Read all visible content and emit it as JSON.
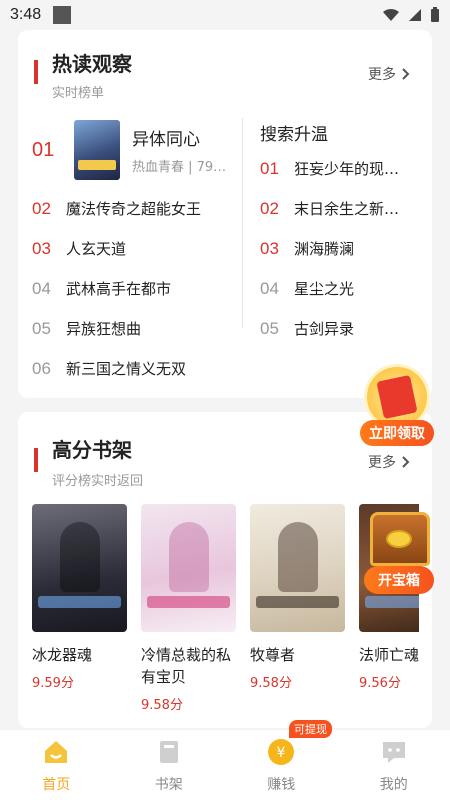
{
  "status_bar": {
    "time": "3:48"
  },
  "hot_read": {
    "title": "热读观察",
    "subtitle": "实时榜单",
    "more": "更多",
    "top_book": {
      "rank": "01",
      "title": "异体同心",
      "meta": "热血青春 | 79…"
    },
    "ranks": [
      {
        "rank": "02",
        "title": "魔法传奇之超能女王"
      },
      {
        "rank": "03",
        "title": "人玄天道"
      },
      {
        "rank": "04",
        "title": "武林高手在都市"
      },
      {
        "rank": "05",
        "title": "异族狂想曲"
      },
      {
        "rank": "06",
        "title": "新三国之情义无双"
      }
    ],
    "search_title": "搜索升温",
    "search_ranks": [
      {
        "rank": "01",
        "title": "狂妄少年的现…"
      },
      {
        "rank": "02",
        "title": "末日余生之新…"
      },
      {
        "rank": "03",
        "title": "渊海腾澜"
      },
      {
        "rank": "04",
        "title": "星尘之光"
      },
      {
        "rank": "05",
        "title": "古剑异录"
      }
    ]
  },
  "high_score": {
    "title": "高分书架",
    "subtitle": "评分榜实时返回",
    "more": "更多",
    "books": [
      {
        "name": "冰龙器魂",
        "score": "9.59分"
      },
      {
        "name": "冷情总裁的私有宝贝",
        "score": "9.58分"
      },
      {
        "name": "牧尊者",
        "score": "9.58分"
      },
      {
        "name": "法师亡魂",
        "score": "9.56分"
      }
    ]
  },
  "promos": {
    "red_packet": "立即领取",
    "treasure": "开宝箱"
  },
  "bottom_nav": {
    "items": [
      {
        "label": "首页"
      },
      {
        "label": "书架"
      },
      {
        "label": "赚钱"
      },
      {
        "label": "我的"
      }
    ],
    "badge": "可提现"
  },
  "colors": {
    "accent": "#d9342b",
    "nav_active": "#f5a623",
    "promo": "#f5521f"
  }
}
